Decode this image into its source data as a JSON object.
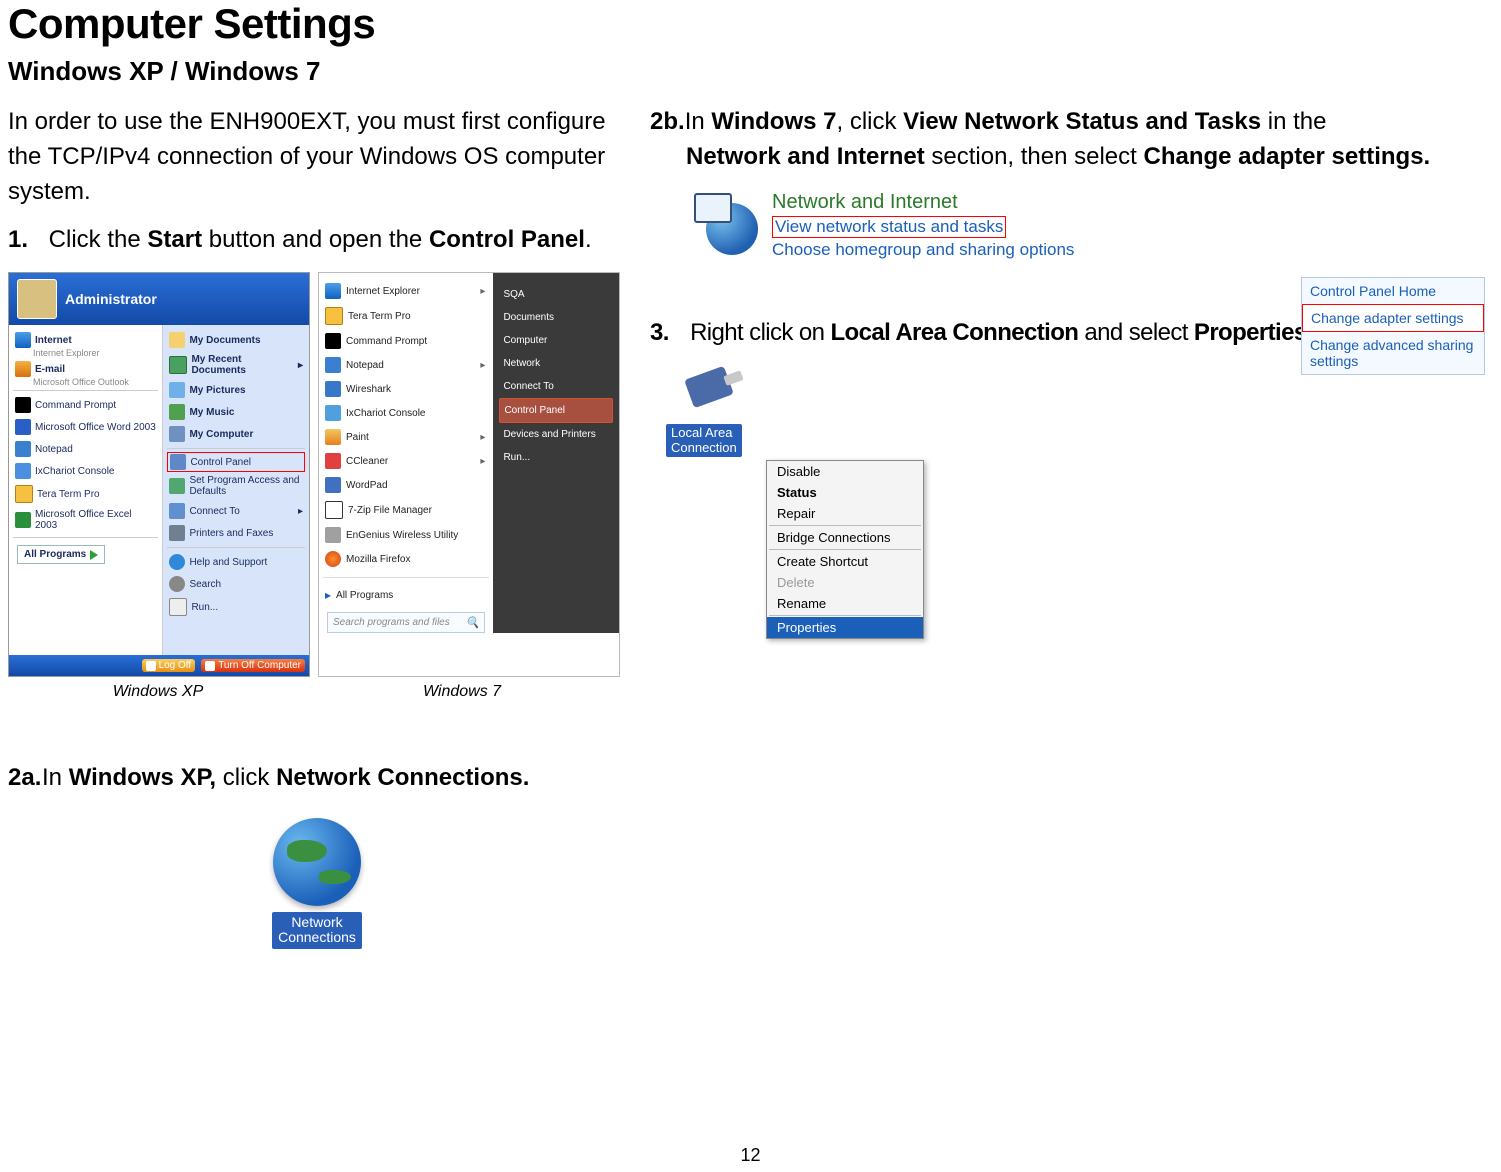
{
  "title": "Computer Settings",
  "subtitle": "Windows XP / Windows 7",
  "intro": "In order to use the ENH900EXT, you must first configure the TCP/IPv4 connection of your Windows OS computer system.",
  "step1": {
    "num": "1.",
    "pre": " Click the ",
    "b1": "Start",
    "mid": " button and open the ",
    "b2": "Control Panel",
    "post": "."
  },
  "caption_xp": "Windows XP",
  "caption_7": "Windows 7",
  "step2a": {
    "num": "2a.",
    "pre": "In ",
    "b1": "Windows XP,",
    "mid": " click ",
    "b2": "Network Connections.",
    "post": ""
  },
  "netcon_label_line1": "Network",
  "netcon_label_line2": "Connections",
  "step2b": {
    "num": "2b.",
    "pre": "In ",
    "b1": "Windows 7",
    "mid1": ", click ",
    "b2": "View Network Status and Tasks",
    "mid2": " in the ",
    "b3": "Network and Internet",
    "mid3": " section, then select ",
    "b4": "Change adapter settings.",
    "post": ""
  },
  "ni": {
    "title": "Network and Internet",
    "l1": "View network status and tasks",
    "l2": "Choose homegroup and sharing options"
  },
  "cpl_side": {
    "title": "Control Panel Home",
    "l1": "Change adapter settings",
    "l2": "Change advanced sharing settings"
  },
  "step3": {
    "num": "3.",
    "pre": " Right click on ",
    "b1": "Local Area Connection",
    "mid": " and select ",
    "b2": "Properties.",
    "post": ""
  },
  "lan_label_line1": "Local Area",
  "lan_label_line2": "Connection",
  "ctx": {
    "disable": "Disable",
    "status": "Status",
    "repair": "Repair",
    "bridge": "Bridge Connections",
    "shortcut": "Create Shortcut",
    "delete": "Delete",
    "rename": "Rename",
    "properties": "Properties"
  },
  "xp_menu": {
    "admin": "Administrator",
    "left": {
      "ie": "Internet",
      "ie_sub": "Internet Explorer",
      "em": "E-mail",
      "em_sub": "Microsoft Office Outlook",
      "cmd": "Command Prompt",
      "word": "Microsoft Office Word 2003",
      "note": "Notepad",
      "ixc": "IxChariot Console",
      "tt": "Tera Term Pro",
      "xl": "Microsoft Office Excel 2003",
      "all": "All Programs"
    },
    "right": {
      "docs": "My Documents",
      "rdocs": "My Recent Documents",
      "pic": "My Pictures",
      "music": "My Music",
      "comp": "My Computer",
      "cpl": "Control Panel",
      "spad": "Set Program Access and Defaults",
      "con": "Connect To",
      "prn": "Printers and Faxes",
      "help": "Help and Support",
      "sch": "Search",
      "run": "Run..."
    },
    "footer": {
      "logoff": "Log Off",
      "turnoff": "Turn Off Computer"
    }
  },
  "w7_menu": {
    "left": {
      "ie": "Internet Explorer",
      "tt": "Tera Term Pro",
      "cmd": "Command Prompt",
      "np": "Notepad",
      "ws": "Wireshark",
      "ixc": "IxChariot Console",
      "paint": "Paint",
      "cc": "CCleaner",
      "wp": "WordPad",
      "z7": "7-Zip File Manager",
      "eng": "EnGenius Wireless Utility",
      "ff": "Mozilla Firefox",
      "all": "All Programs",
      "search": "Search programs and files"
    },
    "right": {
      "sqa": "SQA",
      "docs": "Documents",
      "comp": "Computer",
      "net": "Network",
      "con": "Connect To",
      "cpl": "Control Panel",
      "dev": "Devices and Printers",
      "run": "Run..."
    }
  },
  "page_number": "12"
}
